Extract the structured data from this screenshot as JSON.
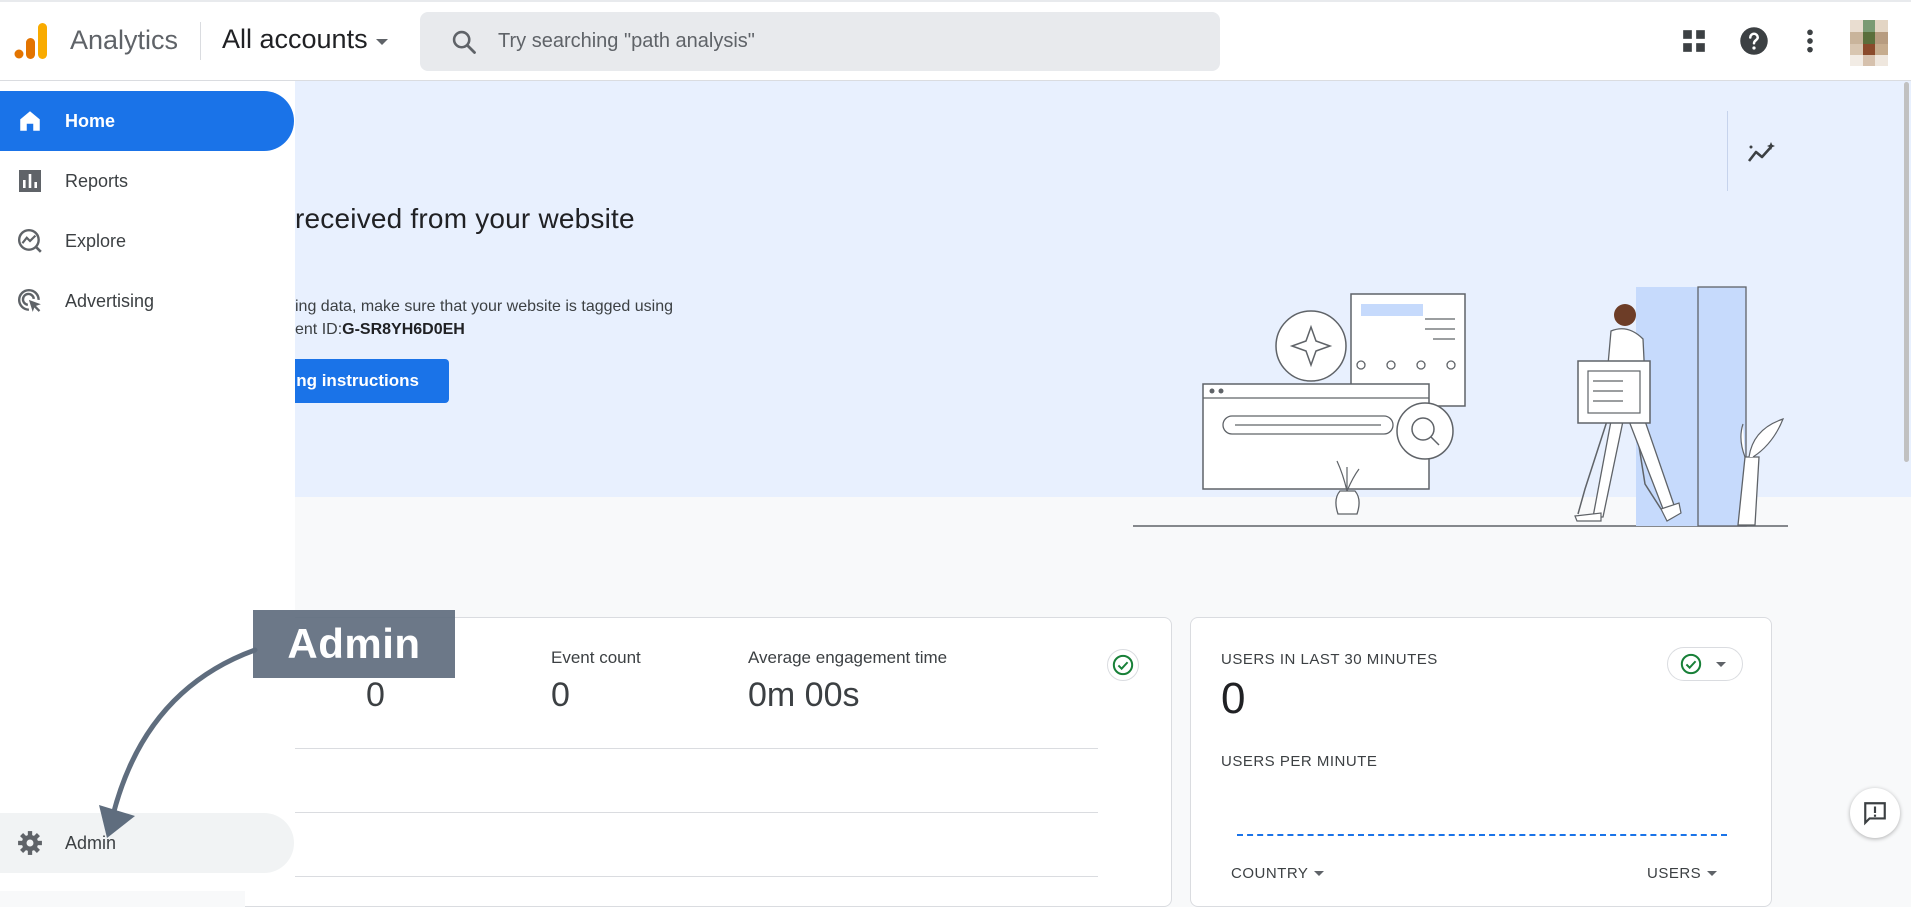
{
  "header": {
    "app_name": "Analytics",
    "account_label": "All accounts",
    "search_placeholder": "Try searching \"path analysis\""
  },
  "sidebar": {
    "items": [
      {
        "label": "Home",
        "icon": "home-icon",
        "active": true
      },
      {
        "label": "Reports",
        "icon": "bar-chart-icon"
      },
      {
        "label": "Explore",
        "icon": "explore-icon"
      },
      {
        "label": "Advertising",
        "icon": "advertising-icon"
      }
    ],
    "admin_label": "Admin"
  },
  "banner": {
    "title": "received from your website",
    "line1": "ing data, make sure that your website is tagged using",
    "line2_prefix": "ent ID:",
    "measurement_id": "G-SR8YH6D0EH",
    "button_label": "ng instructions"
  },
  "overview": {
    "metrics": [
      {
        "label": "Event count",
        "value": "0"
      },
      {
        "label": "Average engagement time",
        "value": "0m 00s"
      }
    ],
    "first_value": "0"
  },
  "realtime": {
    "title": "USERS IN LAST 30 MINUTES",
    "value": "0",
    "per_minute_label": "USERS PER MINUTE",
    "col_country": "COUNTRY",
    "col_users": "USERS"
  },
  "annotation": {
    "label": "Admin"
  },
  "colors": {
    "accent": "#1a73e8",
    "banner_bg": "#e8f0fe",
    "success": "#188038",
    "annotation_bg": "#5f6d7e"
  }
}
